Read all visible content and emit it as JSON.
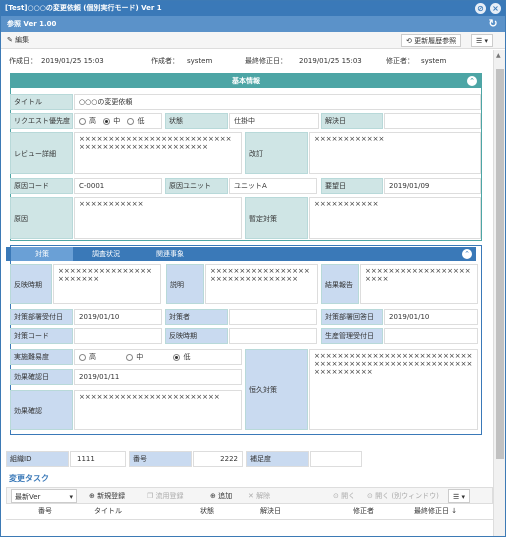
{
  "window": {
    "title": "[Test]○○○の変更依頼 (個別実行モード) Ver 1"
  },
  "header": {
    "title": "参照 Ver 1.00"
  },
  "toolbar": {
    "edit": "編集",
    "history": "更新履歴参照"
  },
  "meta": {
    "created_label": "作成日：",
    "created": "2019/01/25 15:03",
    "creator_label": "作成者：",
    "creator": "system",
    "modified_label": "最終修正日：",
    "modified": "2019/01/25 15:03",
    "modifier_label": "修正者：",
    "modifier": "system"
  },
  "basic": {
    "title": "基本情報",
    "title_label": "タイトル",
    "title_value": "○○○の変更依頼",
    "priority_label": "リクエスト優先度",
    "priority_options": [
      "高",
      "中",
      "低"
    ],
    "priority_selected": "中",
    "status_label": "状態",
    "status_value": "仕掛中",
    "resolved_label": "解決日",
    "resolved_value": "",
    "review_label": "レビュー詳細",
    "review_value": "××××××××××××××××××××××××××××××××××××××××××××××××",
    "revise_label": "改訂",
    "revise_value": "××××××××××××",
    "cause_code_label": "原因コード",
    "cause_code_value": "C-0001",
    "cause_unit_label": "原因ユニット",
    "cause_unit_value": "ユニットA",
    "request_date_label": "要望日",
    "request_date_value": "2019/01/09",
    "cause_label": "原因",
    "cause_value": "×××××××××××",
    "temp_label": "暫定対策",
    "temp_value": "×××××××××××"
  },
  "tabs": [
    "対策",
    "調査状況",
    "関連事象"
  ],
  "measures": {
    "reflect_label": "反映時期",
    "reflect_value": "×××××××××××××××××××××××",
    "explain_label": "説明",
    "explain_value": "××××××××××××××××××××××××××××××××",
    "result_label": "結果報告",
    "result_value": "××××××××××××××××××××××",
    "dept_received_label": "対策部署受付日",
    "dept_received_value": "2019/01/10",
    "person_label": "対策者",
    "person_value": "",
    "dept_reply_label": "対策部署回答日",
    "dept_reply_value": "2019/01/10",
    "code_label": "対策コード",
    "code_value": "",
    "reflect2_label": "反映時期",
    "reflect2_value": "",
    "prod_received_label": "生産管理受付日",
    "prod_received_value": "",
    "difficulty_label": "実施難易度",
    "difficulty_options": [
      "高",
      "中",
      "低"
    ],
    "difficulty_selected": "低",
    "effect_date_label": "効果確認日",
    "effect_date_value": "2019/01/11",
    "effect_label": "効果確認",
    "effect_value": "××××××××××××××××××××××××",
    "permanent_label": "恒久対策",
    "permanent_value": "××××××××××××××××××××××××××××××××××××××××××××××××××××××××××××××××"
  },
  "ids": {
    "org_label": "組織ID",
    "org_value": "1111",
    "num_label": "番号",
    "num_value": "2222",
    "supp_label": "補足度",
    "supp_value": ""
  },
  "task": {
    "heading": "変更タスク",
    "version": "最新Ver",
    "new": "新規登録",
    "reuse": "流用登録",
    "add": "追加",
    "remove": "解除",
    "open": "開く",
    "open_new": "開く (別ウィンドウ)",
    "columns": [
      "番号",
      "タイトル",
      "状態",
      "解決日",
      "修正者",
      "最終修正日 ↓"
    ]
  }
}
